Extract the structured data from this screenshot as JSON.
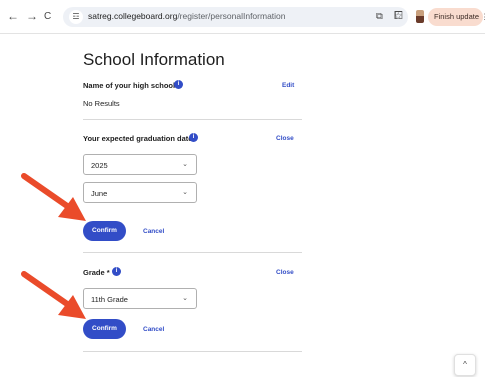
{
  "browser": {
    "back_glyph": "←",
    "forward_glyph": "→",
    "reload_glyph": "C",
    "site_info_glyph": "☲",
    "url_host": "satreg.collegeboard.org",
    "url_path": "/register/personalInformation",
    "translate_glyph": "⧉",
    "bookmark_glyph": "☆",
    "extensions_glyph": "⧠",
    "update_label": "Finish update ⋮"
  },
  "page": {
    "title": "School Information"
  },
  "high_school": {
    "label": "Name of your high school *",
    "info": "i",
    "edit_label": "Edit",
    "value": "No Results"
  },
  "graduation": {
    "label": "Your expected graduation date *",
    "info": "i",
    "close_label": "Close",
    "year_value": "2025",
    "month_value": "June",
    "chevron": "⌄",
    "confirm_label": "Confirm",
    "cancel_label": "Cancel"
  },
  "grade": {
    "label": "Grade *",
    "info": "i",
    "close_label": "Close",
    "grade_value": "11th Grade",
    "chevron": "⌄",
    "confirm_label": "Confirm",
    "cancel_label": "Cancel"
  },
  "scroll_top_glyph": "^",
  "colors": {
    "primary": "#324dc7",
    "arrow": "#ea4b2a",
    "update_pill": "#f9dccf"
  },
  "icons": [
    "back-icon",
    "forward-icon",
    "reload-icon",
    "site-info-icon",
    "translate-icon",
    "bookmark-star-icon",
    "extensions-icon",
    "info-icon",
    "chevron-down-icon",
    "scroll-to-top-icon",
    "annotation-arrow"
  ]
}
